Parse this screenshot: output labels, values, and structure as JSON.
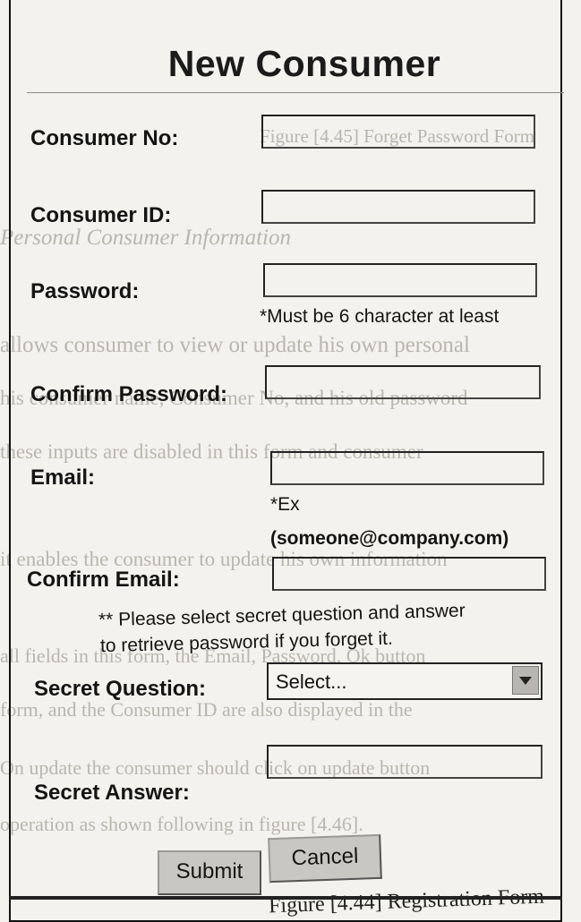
{
  "background_text": {
    "line1": "Figure [4.45] Forget Password Form",
    "line2": "Personal Consumer Information",
    "line3": "allows consumer to view or update his own personal",
    "line4": "his consumer name, Consumer No, and his old password",
    "line5": "these inputs are disabled in this form and consumer",
    "line6": "it enables the consumer to update his own information",
    "line7": "all fields in this form, the Email, Password, Ok button",
    "line8": "form, and the Consumer ID are also displayed in the",
    "line9": "On update the consumer should click on update button",
    "line10": "operation as shown following in figure [4.46].",
    "caption": "Figure [4.44] Registration Form"
  },
  "form": {
    "title": "New Consumer",
    "consumer_no_label": "Consumer No:",
    "consumer_id_label": "Consumer ID:",
    "password_label": "Password:",
    "password_hint": "*Must be 6 character at least",
    "confirm_password_label": "Confirm Password:",
    "email_label": "Email:",
    "email_hint_1": "*Ex",
    "email_hint_2": "(someone@company.com)",
    "confirm_email_label": "Confirm Email:",
    "secret_note_1": "** Please select secret question and answer",
    "secret_note_2": "to retrieve password if you forget it.",
    "secret_question_label": "Secret Question:",
    "secret_question_value": "Select...",
    "secret_answer_label": "Secret Answer:",
    "submit_label": "Submit",
    "cancel_label": "Cancel"
  }
}
